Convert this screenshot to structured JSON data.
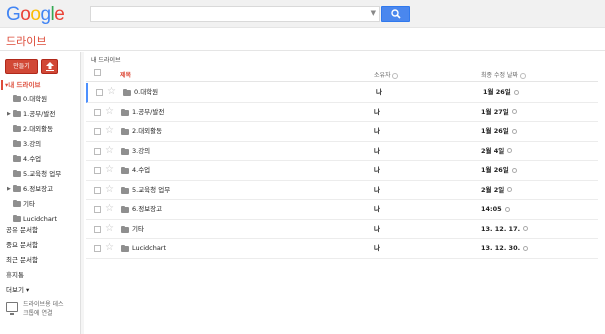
{
  "header": {
    "logo": [
      "G",
      "o",
      "o",
      "g",
      "l",
      "e"
    ],
    "search_placeholder": "",
    "search_icon": "search-icon"
  },
  "app": {
    "title": "드라이브"
  },
  "sidebar": {
    "new_label": "만들기",
    "upload_icon": "upload-icon",
    "my_drive": "내 드라이브",
    "tree": [
      {
        "label": "0.대학원",
        "expandable": false
      },
      {
        "label": "1.공부/발전",
        "expandable": true
      },
      {
        "label": "2.대외활동",
        "expandable": false
      },
      {
        "label": "3.강의",
        "expandable": false
      },
      {
        "label": "4.수업",
        "expandable": false
      },
      {
        "label": "5.교육청 업무",
        "expandable": false
      },
      {
        "label": "6.정보장고",
        "expandable": true
      },
      {
        "label": "기타",
        "expandable": false
      },
      {
        "label": "Lucidchart",
        "expandable": false
      }
    ],
    "links": [
      "공유 문서함",
      "중요 문서함",
      "최근 문서함",
      "휴지통",
      "더보기 ▾"
    ],
    "desktop_promo": [
      "드라이브용 데스",
      "크톱에 연결"
    ]
  },
  "main": {
    "breadcrumb": "내 드라이브",
    "columns": {
      "title": "제목",
      "owner": "소유자",
      "modified": "최종 수정 날짜"
    },
    "rows": [
      {
        "name": "0.대학원",
        "owner": "나",
        "date": "1월 26일"
      },
      {
        "name": "1.공부/발전",
        "owner": "나",
        "date": "1월 27일"
      },
      {
        "name": "2.대외활동",
        "owner": "나",
        "date": "1월 26일"
      },
      {
        "name": "3.강의",
        "owner": "나",
        "date": "2월 4일"
      },
      {
        "name": "4.수업",
        "owner": "나",
        "date": "1월 26일"
      },
      {
        "name": "5.교육청 업무",
        "owner": "나",
        "date": "2월 2일"
      },
      {
        "name": "6.정보장고",
        "owner": "나",
        "date": "14:05"
      },
      {
        "name": "기타",
        "owner": "나",
        "date": "13. 12. 17."
      },
      {
        "name": "Lucidchart",
        "owner": "나",
        "date": "13. 12. 30."
      }
    ]
  },
  "colors": {
    "accent": "#dd4b39",
    "button_blue": "#4a87ee",
    "new_button": "#d14836"
  }
}
